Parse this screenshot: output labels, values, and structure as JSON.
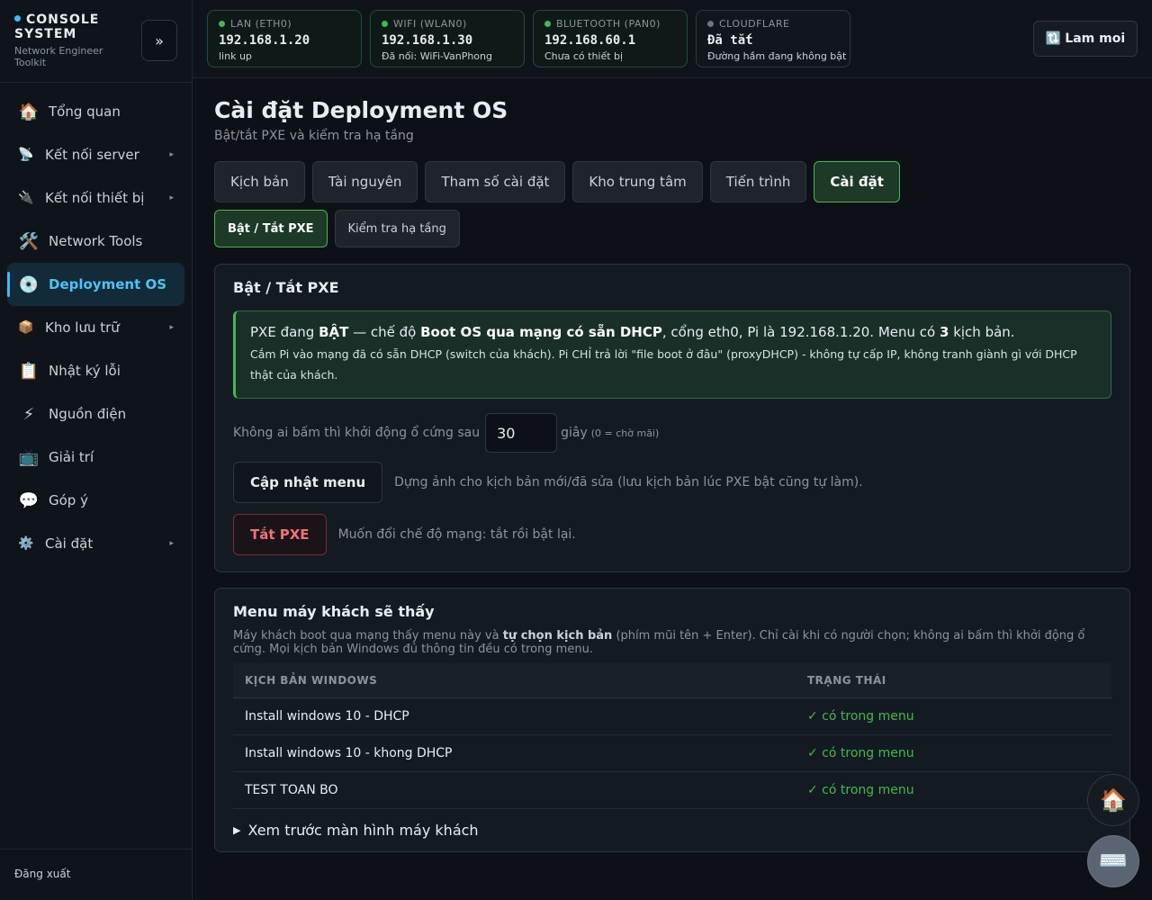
{
  "brand": {
    "title": "CONSOLE SYSTEM",
    "subtitle": "Network Engineer Toolkit",
    "collapse_label": "»"
  },
  "nav": [
    {
      "label": "Tổng quan",
      "icon": "🏠",
      "icon_name": "home-icon"
    },
    {
      "label": "Kết nối server",
      "icon": "📡",
      "icon_name": "satellite-dish-icon",
      "caret": "▸"
    },
    {
      "label": "Kết nối thiết bị",
      "icon": "🔌",
      "icon_name": "plug-icon",
      "caret": "▸"
    },
    {
      "label": "Network Tools",
      "icon": "🛠️",
      "icon_name": "tools-icon"
    },
    {
      "label": "Deployment OS",
      "icon": "💿",
      "icon_name": "disc-icon",
      "active": true
    },
    {
      "label": "Kho lưu trữ",
      "icon": "📦",
      "icon_name": "package-icon",
      "caret": "▸"
    },
    {
      "label": "Nhật ký lỗi",
      "icon": "📋",
      "icon_name": "clipboard-icon"
    },
    {
      "label": "Nguồn điện",
      "icon": "⚡",
      "icon_name": "lightning-icon"
    },
    {
      "label": "Giải trí",
      "icon": "📺",
      "icon_name": "tv-icon"
    },
    {
      "label": "Góp ý",
      "icon": "💬",
      "icon_name": "speech-bubble-icon"
    },
    {
      "label": "Cài đặt",
      "icon": "⚙️",
      "icon_name": "gear-icon",
      "caret": "▸"
    }
  ],
  "logout_label": "Đăng xuất",
  "network": [
    {
      "label": "LAN (ETH0)",
      "ip": "192.168.1.20",
      "status": "link up",
      "state": "on"
    },
    {
      "label": "WIFI (WLAN0)",
      "ip": "192.168.1.30",
      "status": "Đã nối: WiFi-VanPhong",
      "state": "on"
    },
    {
      "label": "BLUETOOTH (PAN0)",
      "ip": "192.168.60.1",
      "status": "Chưa có thiết bị",
      "state": "on"
    },
    {
      "label": "CLOUDFLARE",
      "ip": "Đã tắt",
      "status": "Đường hầm đang không bật",
      "state": "off"
    }
  ],
  "refresh": {
    "icon": "🔃",
    "label": "Lam moi"
  },
  "page": {
    "title": "Cài đặt Deployment OS",
    "subtitle": "Bật/tắt PXE và kiểm tra hạ tầng"
  },
  "tabs": [
    "Kịch bản",
    "Tài nguyên",
    "Tham số cài đặt",
    "Kho trung tâm",
    "Tiến trình",
    "Cài đặt"
  ],
  "subtabs": [
    "Bật / Tắt PXE",
    "Kiểm tra hạ tầng"
  ],
  "pxe": {
    "title": "Bật / Tắt PXE",
    "alert_main_1": "PXE đang ",
    "alert_state": "BẬT",
    "alert_main_2": " — chế độ ",
    "alert_mode": "Boot OS qua mạng có sẵn DHCP",
    "alert_main_3": ", cổng eth0, Pi là 192.168.1.20. Menu có ",
    "alert_count": "3",
    "alert_main_4": " kịch bản.",
    "alert_note": "Cắm Pi vào mạng đã có sẵn DHCP (switch của khách). Pi CHỈ trả lời \"file boot ở đâu\" (proxyDHCP) - không tự cấp IP, không tranh giành gì với DHCP thật của khách.",
    "timeout_label": "Không ai bấm thì khởi động ổ cứng sau",
    "timeout_value": "30",
    "timeout_unit": "giây",
    "timeout_hint": "(0 = chờ mãi)",
    "update_button": "Cập nhật menu",
    "update_note": "Dựng ảnh cho kịch bản mới/đã sửa (lưu kịch bản lúc PXE bật cũng tự làm).",
    "off_button": "Tắt PXE",
    "off_note": "Muốn đổi chế độ mạng: tắt rồi bật lại."
  },
  "menu": {
    "title": "Menu máy khách sẽ thấy",
    "desc_1": "Máy khách boot qua mạng thấy menu này và ",
    "desc_bold": "tự chọn kịch bản",
    "desc_2": " (phím mũi tên + Enter). Chỉ cài khi có người chọn; không ai bấm thì khởi động ổ cứng. Mọi kịch bản Windows đủ thông tin đều có trong menu.",
    "col_name": "KỊCH BẢN WINDOWS",
    "col_status": "TRẠNG THÁI",
    "rows": [
      {
        "name": "Install windows 10 - DHCP",
        "status": "✓ có trong menu"
      },
      {
        "name": "Install windows 10 - khong DHCP",
        "status": "✓ có trong menu"
      },
      {
        "name": "TEST TOAN BO",
        "status": "✓ có trong menu"
      }
    ],
    "preview_label": "Xem trước màn hình máy khách"
  },
  "fab": {
    "home_icon": "🏠",
    "keyboard_icon": "⌨️"
  }
}
